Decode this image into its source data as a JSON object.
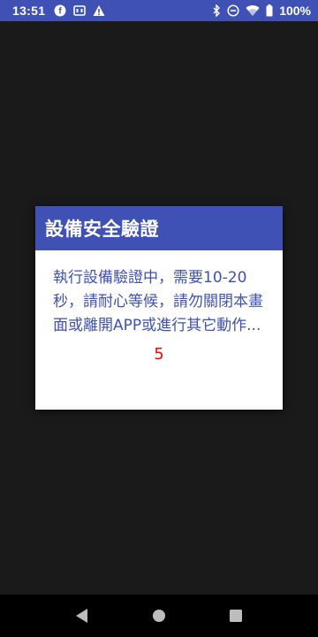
{
  "status_bar": {
    "time": "13:51",
    "battery_percent": "100%",
    "left_icons": [
      "f-app-icon",
      "sim-card-icon",
      "warning-icon"
    ],
    "right_icons": [
      "bluetooth-icon",
      "do-not-disturb-icon",
      "wifi-icon",
      "battery-icon"
    ],
    "background_color": "#3f51b5"
  },
  "dialog": {
    "title": "設備安全驗證",
    "message": "執行設備驗證中，需要10-20秒，請耐心等候，請勿關閉本畫面或離開APP或進行其它動作...",
    "countdown": "5",
    "header_color": "#3f51b5",
    "countdown_color": "#ff0000"
  },
  "nav_bar": {
    "buttons": [
      "back-icon",
      "home-icon",
      "recents-icon"
    ]
  }
}
